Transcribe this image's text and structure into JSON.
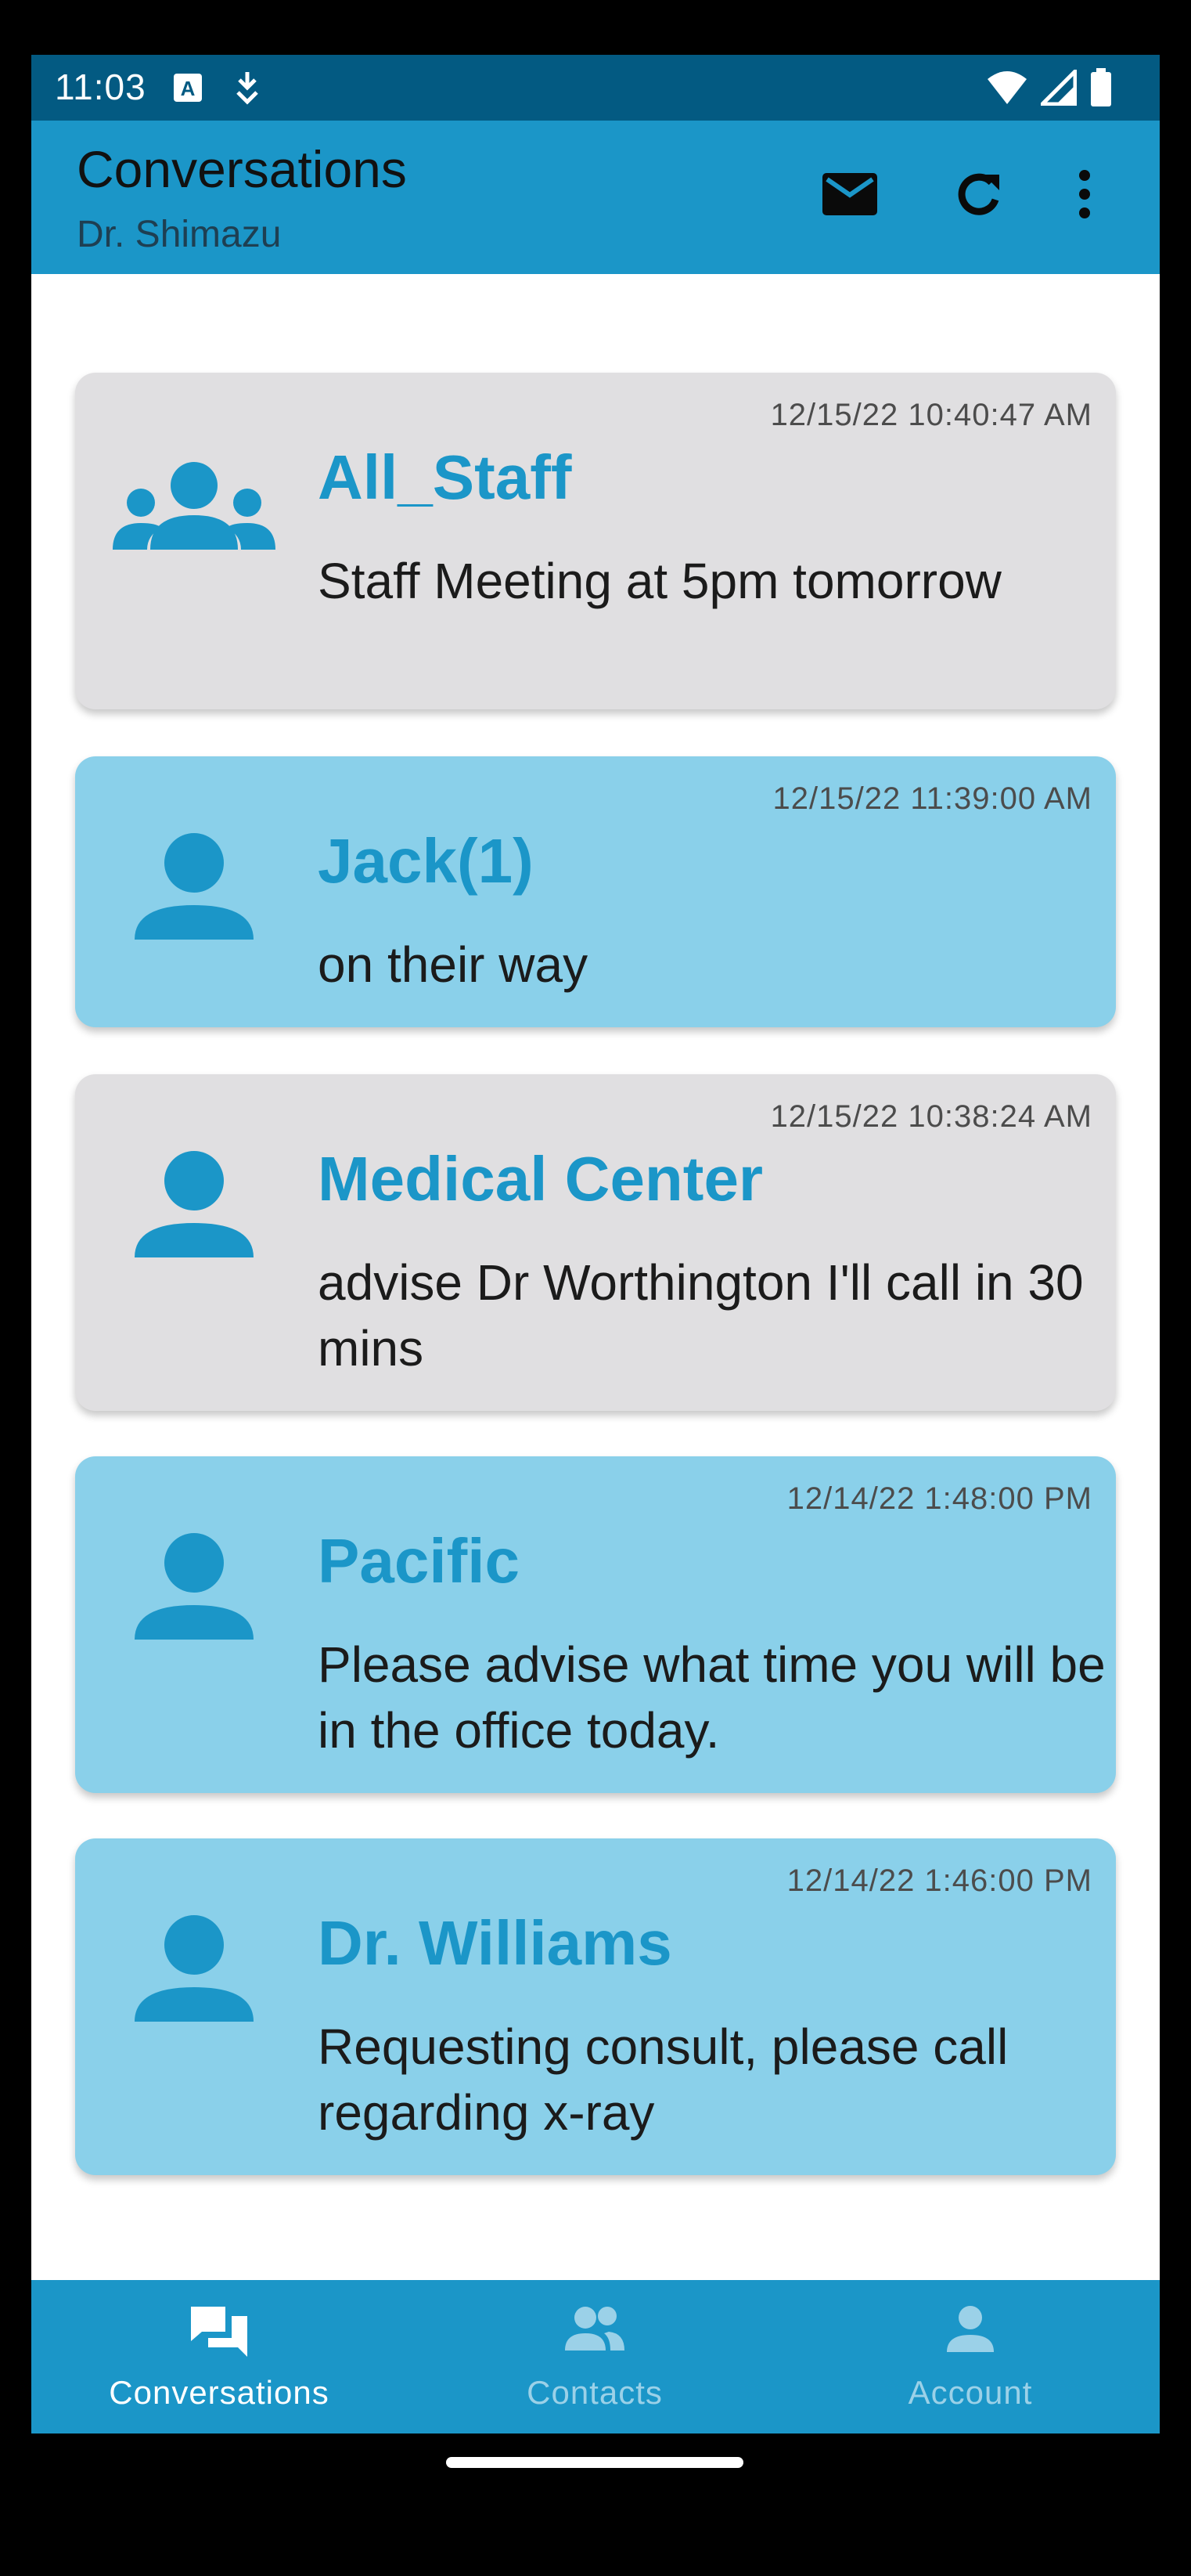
{
  "status_bar": {
    "time": "11:03"
  },
  "app_bar": {
    "title": "Conversations",
    "subtitle": "Dr. Shimazu",
    "actions": [
      "mail-icon",
      "refresh-icon",
      "more-vert-icon"
    ]
  },
  "conversations": [
    {
      "timestamp": "12/15/22 10:40:47 AM",
      "name": "All_Staff",
      "message": "Staff Meeting at 5pm tomorrow",
      "icon": "group-icon",
      "style": "grey"
    },
    {
      "timestamp": "12/15/22 11:39:00 AM",
      "name": "Jack(1)",
      "message": "on their way",
      "icon": "person-icon",
      "style": "blue"
    },
    {
      "timestamp": "12/15/22 10:38:24 AM",
      "name": "Medical Center",
      "message": "advise Dr  Worthington I'll call in 30 mins",
      "icon": "person-icon",
      "style": "grey"
    },
    {
      "timestamp": "12/14/22 1:48:00 PM",
      "name": "Pacific",
      "message": "Please advise what time you will be in the office today.",
      "icon": "person-icon",
      "style": "blue"
    },
    {
      "timestamp": "12/14/22 1:46:00 PM",
      "name": "Dr. Williams",
      "message": "Requesting consult, please call regarding x-ray",
      "icon": "person-icon",
      "style": "blue"
    }
  ],
  "bottom_nav": [
    {
      "label": "Conversations",
      "icon": "forum-icon",
      "active": true
    },
    {
      "label": "Contacts",
      "icon": "people-icon",
      "active": false
    },
    {
      "label": "Account",
      "icon": "account-icon",
      "active": false
    }
  ],
  "colors": {
    "primary": "#1b96c8",
    "status_bar": "#035a82",
    "card_grey": "#e0dfe1",
    "card_blue": "#8ad0ea",
    "name_text": "#1b96c8"
  }
}
